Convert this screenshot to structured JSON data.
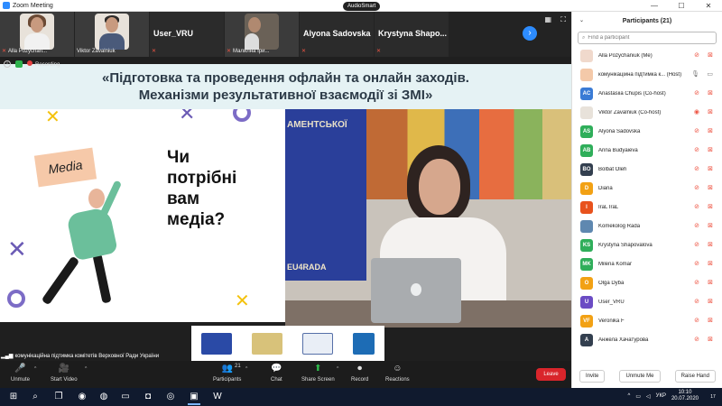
{
  "window": {
    "title": "Zoom Meeting",
    "audio_badge": "AudioSmart"
  },
  "thumbnails": [
    {
      "name": "Alla Pozychan...",
      "type": "photo-woman"
    },
    {
      "name": "Viktor Zavalniuk",
      "type": "photo-man"
    },
    {
      "name": "User_VRU",
      "type": "name"
    },
    {
      "name": "Малилна Іри...",
      "type": "photo-group"
    },
    {
      "name": "Alyona Sadovska",
      "type": "name"
    },
    {
      "name": "Krystyna Shapo...",
      "type": "name"
    }
  ],
  "recording": {
    "label": "Recording"
  },
  "slide": {
    "title_line1": "«Підготовка та проведення офлайн та онлайн заходів.",
    "title_line2": "Механізми результативної взаємодії зі ЗМІ»",
    "media_sign": "Media",
    "question_line1": "Чи",
    "question_line2": "потрібні",
    "question_line3": "вам",
    "question_line4": "медіа?",
    "wall_text": "АМЕНТСЬКОЇ",
    "wall_text2": "EU4RADA"
  },
  "active_speaker": "комунікаційна підтимка комітетів Верховної Ради України",
  "toolbar": {
    "unmute": "Unmute",
    "start_video": "Start Video",
    "participants": "Participants",
    "participants_count": "21",
    "chat": "Chat",
    "share_screen": "Share Screen",
    "record": "Record",
    "reactions": "Reactions",
    "leave": "Leave"
  },
  "panel": {
    "title": "Participants (21)",
    "search_placeholder": "Find a participant",
    "participants": [
      {
        "name": "Alla Pozychaniuk (Me)",
        "avatar": "",
        "color": "#f0d9cc",
        "mic": "off",
        "cam": "off"
      },
      {
        "name": "комунікаційна підтимка к... (Host)",
        "avatar": "",
        "color": "#f4c9a9",
        "mic": "on",
        "cam": "on"
      },
      {
        "name": "Anastasiia Chupis (Co-host)",
        "avatar": "AC",
        "color": "#3a7bd5",
        "mic": "off",
        "cam": "off"
      },
      {
        "name": "Viktor Zavalniuk (Co-host)",
        "avatar": "",
        "color": "#e8e2da",
        "mic": "rec",
        "cam": "off"
      },
      {
        "name": "Alyona Sadovska",
        "avatar": "AS",
        "color": "#2fae5a",
        "mic": "off",
        "cam": "off"
      },
      {
        "name": "Anna Budyaieva",
        "avatar": "AB",
        "color": "#2fae5a",
        "mic": "off",
        "cam": "off"
      },
      {
        "name": "Bolbat Oleh",
        "avatar": "BO",
        "color": "#333f4f",
        "mic": "off",
        "cam": "off"
      },
      {
        "name": "Diana",
        "avatar": "D",
        "color": "#f2a114",
        "mic": "off",
        "cam": "off"
      },
      {
        "name": "IraL IraL",
        "avatar": "I",
        "color": "#e8521d",
        "mic": "off",
        "cam": "off"
      },
      {
        "name": "Komekolog Rada",
        "avatar": "",
        "color": "#5f88b0",
        "mic": "off",
        "cam": "off"
      },
      {
        "name": "Krystyna Shapovalova",
        "avatar": "KS",
        "color": "#2fae5a",
        "mic": "off",
        "cam": "off"
      },
      {
        "name": "Milena Komar",
        "avatar": "MK",
        "color": "#2fae5a",
        "mic": "off",
        "cam": "off"
      },
      {
        "name": "Olga Dyba",
        "avatar": "O",
        "color": "#f2a114",
        "mic": "off",
        "cam": "off"
      },
      {
        "name": "User_VRU",
        "avatar": "U",
        "color": "#6b4cc4",
        "mic": "off",
        "cam": "off"
      },
      {
        "name": "Veronika F",
        "avatar": "VF",
        "color": "#f2a114",
        "mic": "off",
        "cam": "off"
      },
      {
        "name": "Анжела Хачатурова",
        "avatar": "A",
        "color": "#333f4f",
        "mic": "off",
        "cam": "off"
      }
    ],
    "invite": "Invite",
    "unmute_me": "Unmute Me",
    "raise_hand": "Raise Hand"
  },
  "taskbar": {
    "lang": "УКР",
    "time": "10:10",
    "date": "20.07.2020",
    "notif_count": "17"
  }
}
